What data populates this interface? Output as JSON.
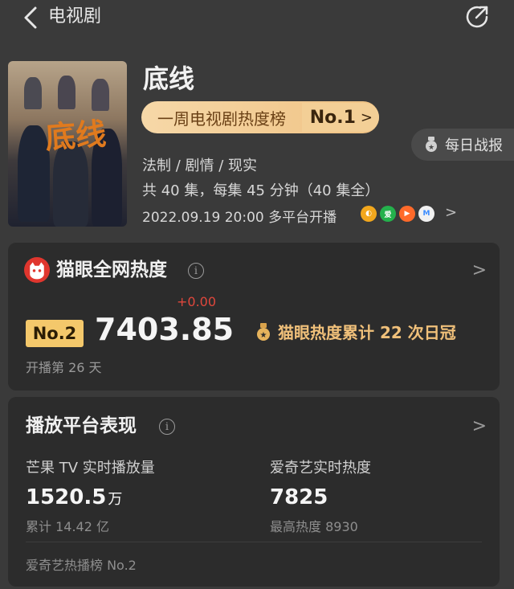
{
  "nav": {
    "title": "电视剧"
  },
  "show": {
    "poster_title": "底线",
    "title": "底线",
    "rank_label": "一周电视剧热度榜",
    "rank_no": "No.1",
    "genre": "法制 / 剧情 / 现实",
    "episodes": "共 40 集，每集 45 分钟（40 集全）",
    "airdate": "2022.09.19 20:00 多平台开播",
    "platforms": [
      {
        "icon": "mango-tv-icon",
        "color": "#f2a71d",
        "glyph": "◐"
      },
      {
        "icon": "iqiyi-icon",
        "color": "#24b14c",
        "glyph": "爱"
      },
      {
        "icon": "tencent-video-icon",
        "color": "#ff6a2a",
        "glyph": "▶"
      },
      {
        "icon": "youku-icon",
        "color": "#3b8cff",
        "glyph": "M"
      }
    ],
    "daily_report": "每日战报"
  },
  "maoyan": {
    "title": "猫眼全网热度",
    "rank": "No.2",
    "heat": "7403.85",
    "delta": "+0.00",
    "streak": "猫眼热度累计 22 次日冠",
    "days_aired": "开播第 26 天"
  },
  "platform_perf": {
    "title": "播放平台表现",
    "left": {
      "label": "芒果 TV 实时播放量",
      "value": "1520.5",
      "unit": "万",
      "sub": "累计 14.42 亿"
    },
    "right": {
      "label": "爱奇艺实时热度",
      "value": "7825",
      "sub": "最高热度 8930"
    },
    "footer": "爱奇艺热播榜 No.2"
  },
  "colors": {
    "background": "#3a3a3a",
    "card": "#2c2c2c",
    "rank_pill": "#f0c283",
    "rank_box": "#f4c86b",
    "accent_gold": "#f0c07a",
    "delta_red": "#e0473c"
  }
}
